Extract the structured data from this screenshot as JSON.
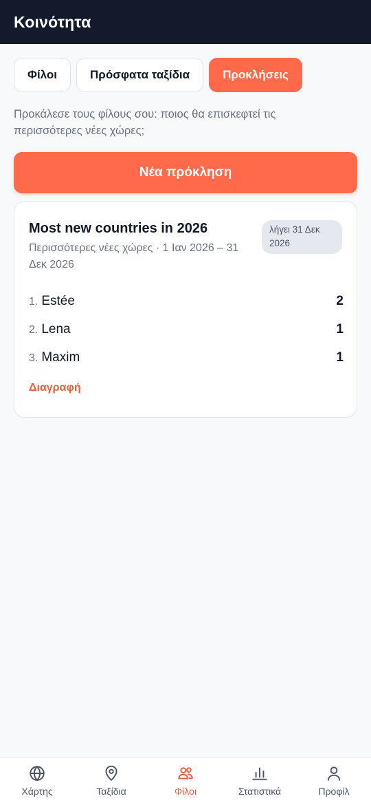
{
  "header": {
    "title": "Κοινότητα"
  },
  "tabs": [
    {
      "label": "Φίλοι",
      "active": false
    },
    {
      "label": "Πρόσφατα ταξίδια",
      "active": false
    },
    {
      "label": "Προκλήσεις",
      "active": true
    }
  ],
  "intro": "Προκάλεσε τους φίλους σου: ποιος θα επισκεφτεί τις περισσότερες νέες χώρες;",
  "new_challenge_label": "Νέα πρόκληση",
  "challenge": {
    "title": "Most new countries in 2026",
    "subtitle": "Περισσότερες νέες χώρες · 1 Ιαν 2026 – 31 Δεκ 2026",
    "badge": "λήγει 31 Δεκ 2026",
    "leaderboard": [
      {
        "rank": "1.",
        "name": "Estée",
        "score": "2"
      },
      {
        "rank": "2.",
        "name": "Lena",
        "score": "1"
      },
      {
        "rank": "3.",
        "name": "Maxim",
        "score": "1"
      }
    ],
    "delete_label": "Διαγραφή"
  },
  "bottom_nav": [
    {
      "label": "Χάρτης",
      "icon": "globe-icon",
      "active": false
    },
    {
      "label": "Ταξίδια",
      "icon": "map-pin-icon",
      "active": false
    },
    {
      "label": "Φίλοι",
      "icon": "users-icon",
      "active": true
    },
    {
      "label": "Στατιστικά",
      "icon": "bar-chart-icon",
      "active": false
    },
    {
      "label": "Προφίλ",
      "icon": "user-icon",
      "active": false
    }
  ],
  "colors": {
    "header_bg": "#121a2b",
    "accent": "#ff6a4b",
    "accent_text": "#e8613f",
    "muted_text": "#6b7280",
    "page_bg": "#f7f9fb"
  }
}
